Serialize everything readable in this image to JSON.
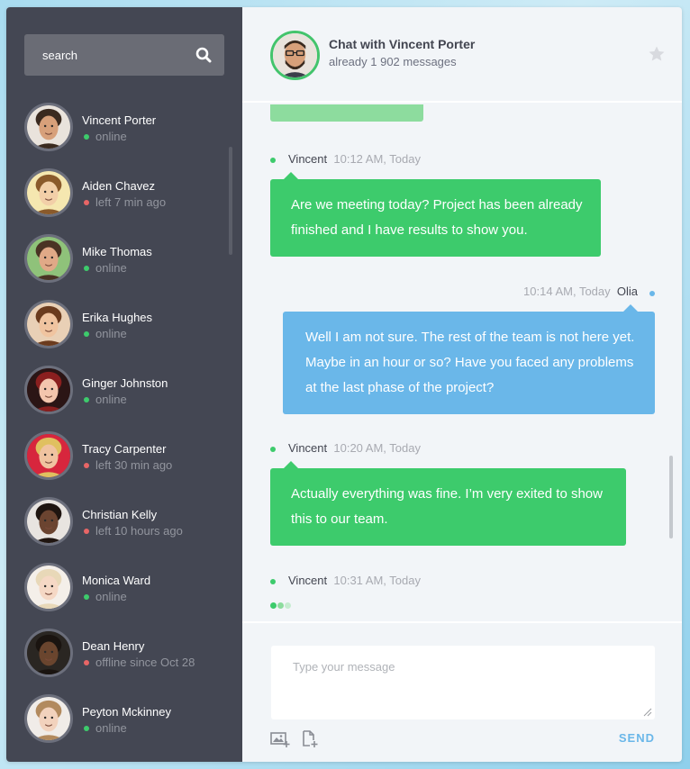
{
  "colors": {
    "sidebar_bg": "#444753",
    "online": "#3dcb6c",
    "offline": "#e86666",
    "green_bubble": "#3dcb6c",
    "blue_bubble": "#6ab7e9",
    "send": "#6ab7e9"
  },
  "search": {
    "placeholder": "search",
    "icon": "search-icon"
  },
  "contacts": [
    {
      "name": "Vincent Porter",
      "status": "online",
      "state": "online",
      "skin": "#d7a07a",
      "hair": "#3a2a1f",
      "bg": "#e9e3dc"
    },
    {
      "name": "Aiden Chavez",
      "status": "left 7 min ago",
      "state": "offline",
      "skin": "#f2cfa8",
      "hair": "#8a5a2b",
      "bg": "#f5e7b0"
    },
    {
      "name": "Mike Thomas",
      "status": "online",
      "state": "online",
      "skin": "#e0a987",
      "hair": "#4a3324",
      "bg": "#8fc27a"
    },
    {
      "name": "Erika Hughes",
      "status": "online",
      "state": "online",
      "skin": "#f0c4a0",
      "hair": "#6b3b1e",
      "bg": "#e9d0b6"
    },
    {
      "name": "Ginger Johnston",
      "status": "online",
      "state": "online",
      "skin": "#f3c5ad",
      "hair": "#8a1f1f",
      "bg": "#2b1515"
    },
    {
      "name": "Tracy Carpenter",
      "status": "left 30 min ago",
      "state": "offline",
      "skin": "#f0c3a0",
      "hair": "#e0c060",
      "bg": "#d7263d"
    },
    {
      "name": "Christian Kelly",
      "status": "left 10 hours ago",
      "state": "offline",
      "skin": "#6b4430",
      "hair": "#1f1510",
      "bg": "#e8e4e0"
    },
    {
      "name": "Monica Ward",
      "status": "online",
      "state": "online",
      "skin": "#f5d8c5",
      "hair": "#e8d8b8",
      "bg": "#f4efe9"
    },
    {
      "name": "Dean Henry",
      "status": "offline since Oct 28",
      "state": "offline",
      "skin": "#6a452e",
      "hair": "#1a1410",
      "bg": "#2a2622"
    },
    {
      "name": "Peyton Mckinney",
      "status": "online",
      "state": "online",
      "skin": "#f2d2bd",
      "hair": "#b28a5e",
      "bg": "#f0ece8"
    }
  ],
  "header": {
    "title": "Chat with Vincent Porter",
    "subtitle": "already 1 902 messages",
    "star_icon": "star-icon"
  },
  "messages": [
    {
      "author": "Vincent",
      "time": "10:12 AM, Today",
      "side": "left",
      "color": "green",
      "lines": [
        "Are we meeting today? Project has been already",
        "finished and I have results to show you."
      ]
    },
    {
      "author": "Olia",
      "time": "10:14 AM, Today",
      "side": "right",
      "color": "blue",
      "lines": [
        "Well I am not sure. The rest of the team is not here yet.",
        "Maybe  in an hour or so?  Have you faced any problems",
        "at the last phase of the project?"
      ]
    },
    {
      "author": "Vincent",
      "time": "10:20 AM, Today",
      "side": "left",
      "color": "green",
      "lines": [
        "Actually everything was fine. I’m very exited to show",
        "this to our team."
      ]
    },
    {
      "author": "Vincent",
      "time": "10:31 AM, Today",
      "side": "left",
      "typing": true
    }
  ],
  "composer": {
    "placeholder": "Type your message",
    "send_label": "SEND",
    "image_icon": "image-add-icon",
    "file_icon": "file-add-icon"
  }
}
